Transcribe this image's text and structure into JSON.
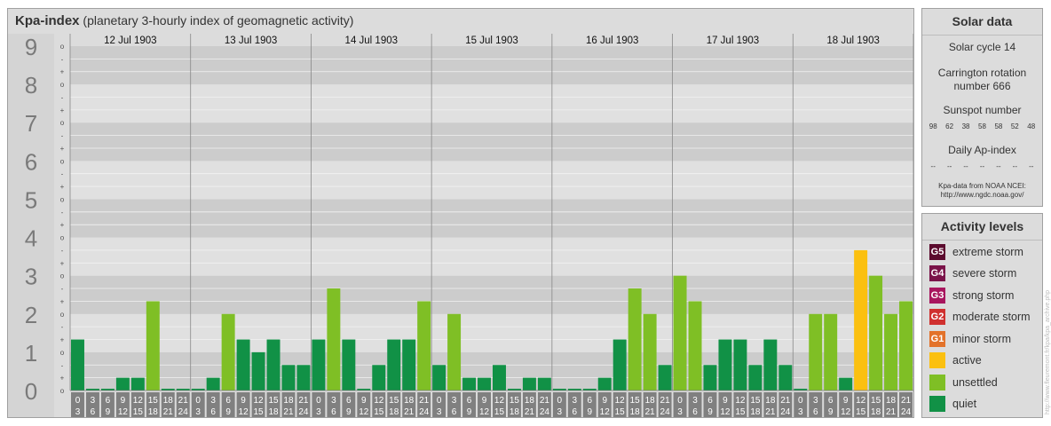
{
  "title": {
    "bold": "Kpa-index",
    "subtitle": "(planetary 3-hourly index of geomagnetic activity)"
  },
  "chart_data": {
    "type": "bar",
    "title": "Kpa-index",
    "subtitle": "(planetary 3-hourly index of geomagnetic activity)",
    "ylim": [
      0,
      9
    ],
    "yticks": [
      "0",
      "1",
      "2",
      "3",
      "4",
      "5",
      "6",
      "7",
      "8",
      "9"
    ],
    "minor_ticks": [
      "o",
      "+",
      "-",
      "o",
      "+",
      "-",
      "o",
      "+",
      "-",
      "o",
      "+",
      "-",
      "o",
      "+",
      "-",
      "o",
      "+",
      "-",
      "o",
      "+",
      "-",
      "o",
      "+",
      "-",
      "o",
      "+",
      "-",
      "o"
    ],
    "days": [
      "12 Jul 1903",
      "13 Jul 1903",
      "14 Jul 1903",
      "15 Jul 1903",
      "16 Jul 1903",
      "17 Jul 1903",
      "18 Jul 1903"
    ],
    "hour_start": [
      "0",
      "3",
      "6",
      "9",
      "12",
      "15",
      "18",
      "21"
    ],
    "hour_end": [
      "3",
      "6",
      "9",
      "12",
      "15",
      "18",
      "21",
      "24"
    ],
    "values": [
      1.333,
      0,
      0,
      0.333,
      0.333,
      2.333,
      0,
      0,
      0,
      0.333,
      2,
      1.333,
      1,
      1.333,
      0.667,
      0.667,
      1.333,
      2.667,
      1.333,
      0,
      0.667,
      1.333,
      1.333,
      2.333,
      0.667,
      2,
      0.333,
      0.333,
      0.667,
      0,
      0.333,
      0.333,
      0,
      0,
      0,
      0.333,
      1.333,
      2.667,
      2,
      0.667,
      3,
      2.333,
      0.667,
      1.333,
      1.333,
      0.667,
      1.333,
      0.667,
      0,
      2,
      2,
      0.333,
      3.667,
      3,
      2,
      2.333
    ],
    "grid": true
  },
  "solar": {
    "header": "Solar data",
    "cycle": "Solar cycle 14",
    "carrington1": "Carrington rotation",
    "carrington2": "number 666",
    "sunspot_label": "Sunspot number",
    "sunspots": [
      "98",
      "62",
      "38",
      "58",
      "58",
      "52",
      "48"
    ],
    "ap_label": "Daily Ap-index",
    "ap": [
      "--",
      "--",
      "--",
      "--",
      "--",
      "--",
      "--"
    ],
    "note1": "Kpa-data from NOAA NCEI:",
    "note2": "http://www.ngdc.noaa.gov/"
  },
  "levels": {
    "header": "Activity levels",
    "items": [
      {
        "badge": "G5",
        "label": "extreme storm",
        "color": "#5c0b2e"
      },
      {
        "badge": "G4",
        "label": "severe storm",
        "color": "#7a1349"
      },
      {
        "badge": "G3",
        "label": "strong storm",
        "color": "#a8155e"
      },
      {
        "badge": "G2",
        "label": "moderate storm",
        "color": "#d0302f"
      },
      {
        "badge": "G1",
        "label": "minor storm",
        "color": "#e3722a"
      },
      {
        "badge": "",
        "label": "active",
        "color": "#fbc010"
      },
      {
        "badge": "",
        "label": "unsettled",
        "color": "#7fbf25"
      },
      {
        "badge": "",
        "label": "quiet",
        "color": "#119146"
      }
    ]
  },
  "watermark": "http://www.fleuremont.fr/kpa/kpa_archive.php",
  "colors": {
    "quiet": "#119146",
    "unsettled": "#7fbf25",
    "active": "#fbc010"
  }
}
